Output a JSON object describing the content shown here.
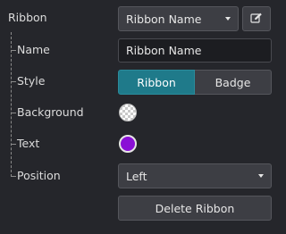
{
  "ribbon": {
    "label": "Ribbon",
    "selector_value": "Ribbon Name",
    "edit_icon": "edit-icon"
  },
  "fields": {
    "name": {
      "label": "Name",
      "value": "Ribbon Name"
    },
    "style": {
      "label": "Style",
      "options": [
        "Ribbon",
        "Badge"
      ],
      "selected": "Ribbon"
    },
    "background": {
      "label": "Background",
      "color": "transparent"
    },
    "text": {
      "label": "Text",
      "color": "#8a10d6"
    },
    "position": {
      "label": "Position",
      "value": "Left"
    }
  },
  "actions": {
    "delete_label": "Delete Ribbon"
  },
  "colors": {
    "accent": "#1f7a8a",
    "panel_bg": "#25262b",
    "control_bg": "#3d3e44"
  }
}
